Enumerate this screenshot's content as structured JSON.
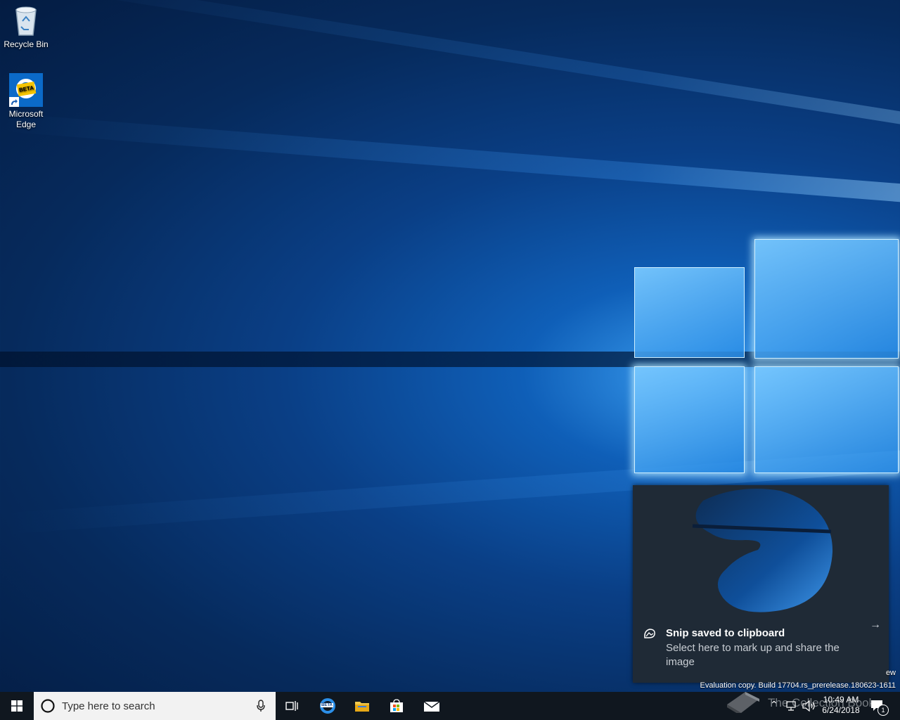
{
  "desktop": {
    "icons": [
      {
        "label": "Recycle Bin"
      },
      {
        "label": "Microsoft\nEdge",
        "line1": "Microsoft",
        "line2": "Edge"
      }
    ],
    "edge_badge": "BETA"
  },
  "toast": {
    "title": "Snip saved to clipboard",
    "body": "Select here to mark up and share the image"
  },
  "watermark": {
    "line1": "ew",
    "line2": "Evaluation copy. Build 17704.rs_prerelease.180623-1611"
  },
  "taskbar": {
    "search_placeholder": "Type here to search",
    "overlay_text": "The Collection Book",
    "clock_time": "10:49 AM",
    "clock_date": "6/24/2018",
    "notification_count": "1"
  },
  "colors": {
    "accent": "#0a64c8",
    "taskbar": "#10171f",
    "toast_bg": "#1f2a36"
  }
}
